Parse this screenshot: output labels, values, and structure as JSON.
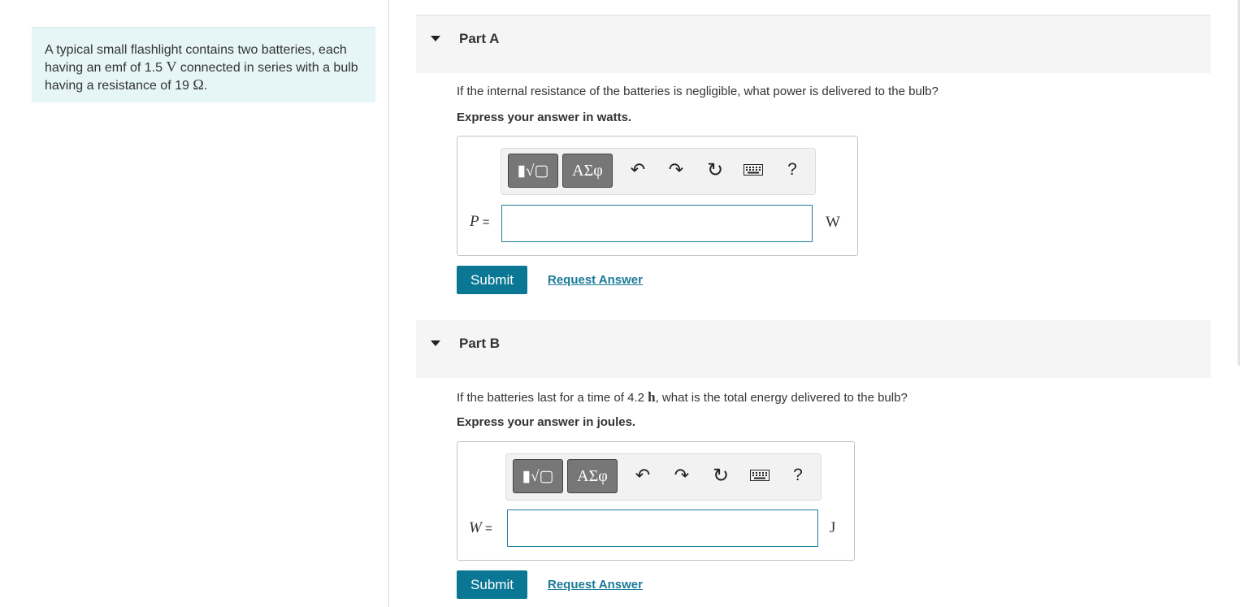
{
  "intro": {
    "text_before_emf": "A typical small flashlight contains two batteries, each having an emf of 1.5 ",
    "emf_unit": "V",
    "text_middle": " connected in series with a bulb having a resistance of 19 ",
    "resistance_unit": "Ω",
    "text_end": "."
  },
  "part_a": {
    "title": "Part A",
    "question": "If the internal resistance of the batteries is negligible, what power is delivered to the bulb?",
    "express": "Express your answer in watts.",
    "toolbar": {
      "template_label": "▮√▢",
      "greek_label": "ΑΣφ",
      "undo_icon": "↶",
      "redo_icon": "↷",
      "reset_icon": "↻",
      "keyboard_icon": "keyboard-icon",
      "help_label": "?"
    },
    "variable": "P",
    "equals": " =",
    "input_value": "",
    "unit": "W",
    "submit": "Submit",
    "request": "Request Answer"
  },
  "part_b": {
    "title": "Part B",
    "question_before": "If the batteries last for a time of 4.2 ",
    "question_unit": "h",
    "question_after": ", what is the total energy delivered to the bulb?",
    "express": "Express your answer in joules.",
    "toolbar": {
      "template_label": "▮√▢",
      "greek_label": "ΑΣφ",
      "undo_icon": "↶",
      "redo_icon": "↷",
      "reset_icon": "↻",
      "keyboard_icon": "keyboard-icon",
      "help_label": "?"
    },
    "variable": "W",
    "equals": " =",
    "input_value": "",
    "unit": "J",
    "submit": "Submit",
    "request": "Request Answer"
  },
  "colors": {
    "intro_bg": "#e6f5f6",
    "submit_bg": "#0a7894",
    "link": "#1a7a97",
    "input_border": "#1c7b9a"
  }
}
